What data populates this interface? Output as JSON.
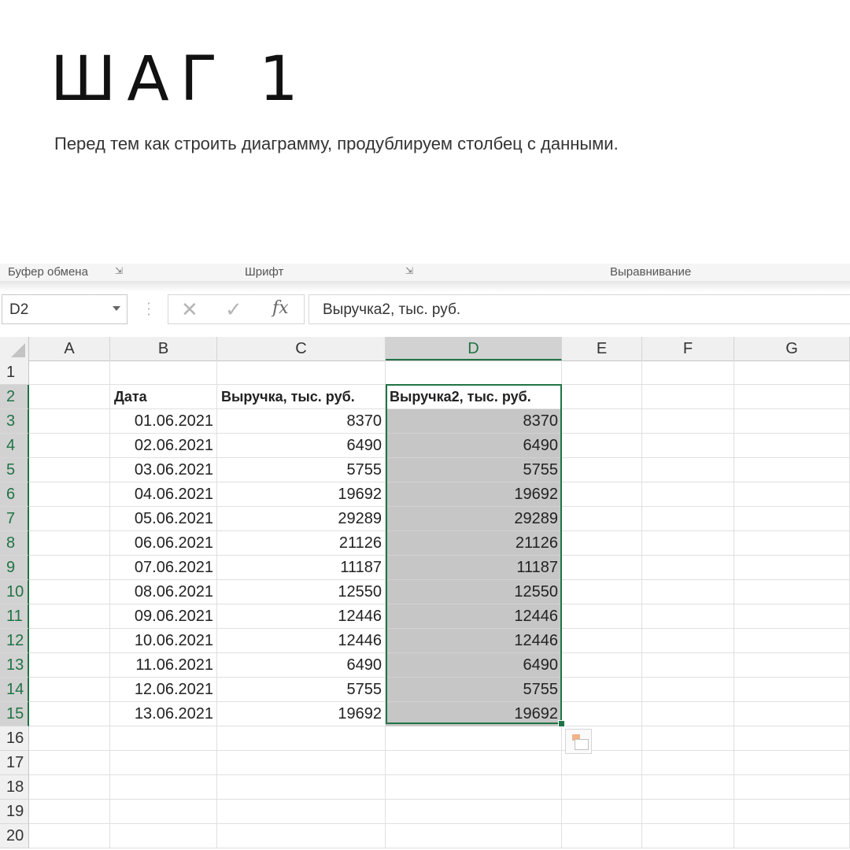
{
  "slide": {
    "title": "ШАГ 1",
    "subtitle": "Перед тем как строить диаграмму, продублируем столбец с данными."
  },
  "ribbon": {
    "group_clipboard": "Буфер обмена",
    "group_font": "Шрифт",
    "group_alignment": "Выравнивание",
    "launcher_icon": "dialog-launcher-icon"
  },
  "formula_bar": {
    "name_box": "D2",
    "cancel_icon": "✕",
    "enter_icon": "✓",
    "fx_label": "fx",
    "content": "Выручка2, тыс. руб."
  },
  "columns": [
    "A",
    "B",
    "C",
    "D",
    "E",
    "F",
    "G"
  ],
  "rows": [
    "1",
    "2",
    "3",
    "4",
    "5",
    "6",
    "7",
    "8",
    "9",
    "10",
    "11",
    "12",
    "13",
    "14",
    "15",
    "16",
    "17",
    "18",
    "19",
    "20"
  ],
  "table": {
    "headers": [
      "Дата",
      "Выручка, тыс. руб.",
      "Выручка2, тыс. руб."
    ],
    "data": [
      [
        "01.06.2021",
        "8370",
        "8370"
      ],
      [
        "02.06.2021",
        "6490",
        "6490"
      ],
      [
        "03.06.2021",
        "5755",
        "5755"
      ],
      [
        "04.06.2021",
        "19692",
        "19692"
      ],
      [
        "05.06.2021",
        "29289",
        "29289"
      ],
      [
        "06.06.2021",
        "21126",
        "21126"
      ],
      [
        "07.06.2021",
        "11187",
        "11187"
      ],
      [
        "08.06.2021",
        "12550",
        "12550"
      ],
      [
        "09.06.2021",
        "12446",
        "12446"
      ],
      [
        "10.06.2021",
        "12446",
        "12446"
      ],
      [
        "11.06.2021",
        "6490",
        "6490"
      ],
      [
        "12.06.2021",
        "5755",
        "5755"
      ],
      [
        "13.06.2021",
        "19692",
        "19692"
      ]
    ]
  },
  "selection": {
    "active_cell": "D2",
    "range": "D2:D15",
    "accent_color": "#217346"
  }
}
